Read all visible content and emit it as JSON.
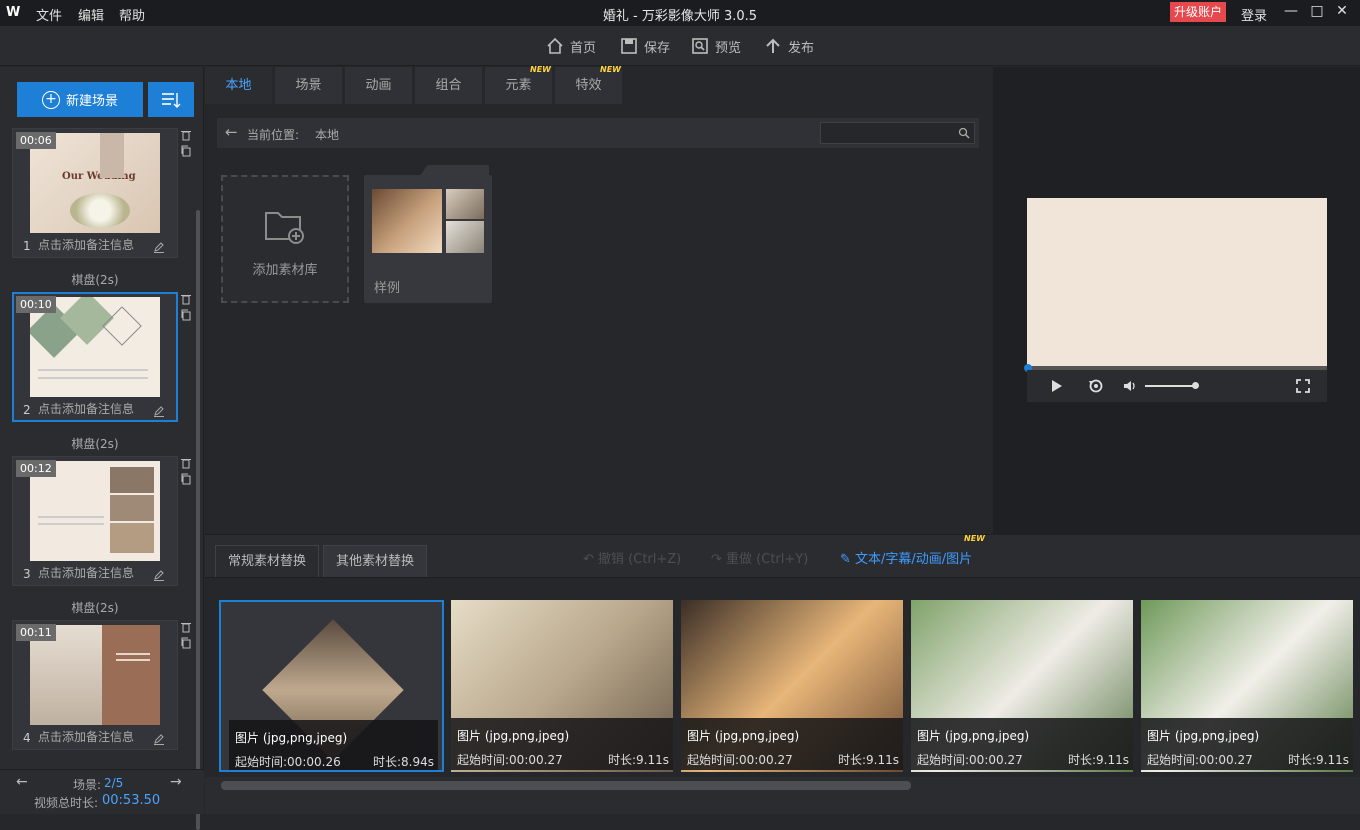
{
  "titlebar": {
    "logo": "W",
    "menus": [
      "文件",
      "编辑",
      "帮助"
    ],
    "title": "婚礼 - 万彩影像大师 3.0.5",
    "upgrade": "升级账户",
    "login": "登录"
  },
  "toolbar": {
    "home": "首页",
    "save": "保存",
    "preview": "预览",
    "publish": "发布"
  },
  "left": {
    "new_scene": "新建场景",
    "scenes": [
      {
        "time": "00:06",
        "num": "1",
        "note": "点击添加备注信息",
        "thumb_text": "Our Wedding"
      },
      {
        "time": "00:10",
        "num": "2",
        "note": "点击添加备注信息"
      },
      {
        "time": "00:12",
        "num": "3",
        "note": "点击添加备注信息"
      },
      {
        "time": "00:11",
        "num": "4",
        "note": "点击添加备注信息"
      }
    ],
    "transitions": [
      "棋盘(2s)",
      "棋盘(2s)",
      "棋盘(2s)"
    ],
    "footer": {
      "scene_label": "场景:",
      "scene_value": "2/5",
      "total_label": "视频总时长:",
      "total_value": "00:53.50"
    }
  },
  "center": {
    "tabs": [
      "本地",
      "场景",
      "动画",
      "组合",
      "元素",
      "特效"
    ],
    "new_badge": "NEW",
    "path_label": "当前位置:",
    "path_value": "本地",
    "search_placeholder": "",
    "add_library": "添加素材库",
    "sample": "样例"
  },
  "bottom": {
    "tabs": [
      "常规素材替换",
      "其他素材替换"
    ],
    "undo": "撤销 (Ctrl+Z)",
    "redo": "重做 (Ctrl+Y)",
    "text_link": "文本/字幕/动画/图片",
    "cards": [
      {
        "type": "图片 (jpg,png,jpeg)",
        "start": "起始时间:00:00.26",
        "dur": "时长:8.94s"
      },
      {
        "type": "图片 (jpg,png,jpeg)",
        "start": "起始时间:00:00.27",
        "dur": "时长:9.11s"
      },
      {
        "type": "图片 (jpg,png,jpeg)",
        "start": "起始时间:00:00.27",
        "dur": "时长:9.11s"
      },
      {
        "type": "图片 (jpg,png,jpeg)",
        "start": "起始时间:00:00.27",
        "dur": "时长:9.11s"
      },
      {
        "type": "图片 (jpg,png,jpeg)",
        "start": "起始时间:00:00.27",
        "dur": "时长:9.11s"
      }
    ]
  },
  "colors": {
    "accent": "#1e7fd6",
    "upgrade": "#e5484d",
    "new_badge": "#ffd23a"
  }
}
